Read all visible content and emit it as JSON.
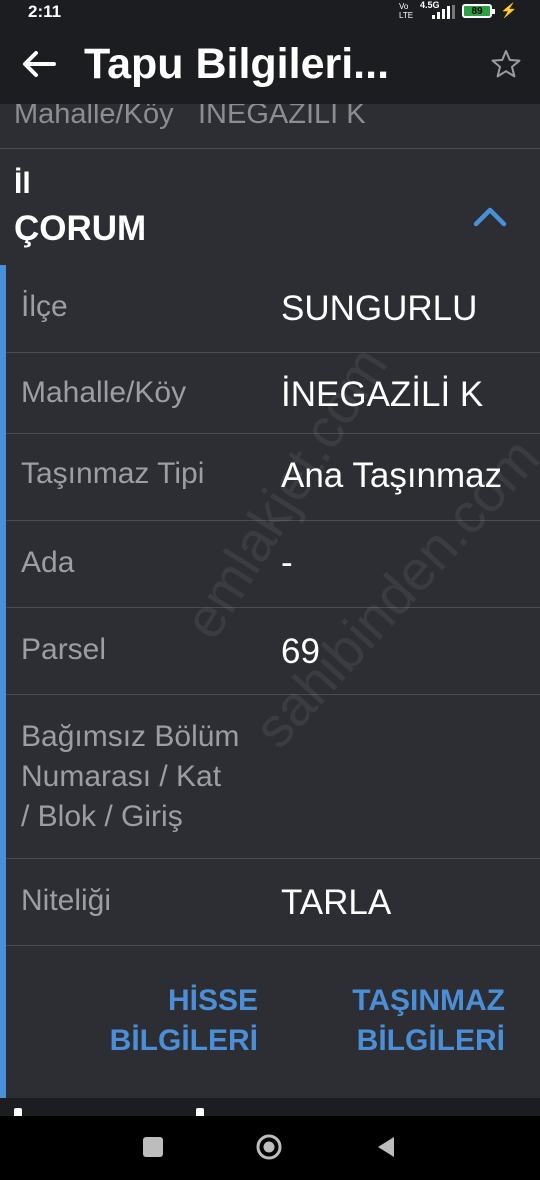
{
  "status_bar": {
    "time": "2:11",
    "volte": "Vo LTE",
    "network": "4.5G",
    "battery": "89"
  },
  "app_bar": {
    "title": "Tapu Bilgileri..."
  },
  "summary": {
    "label": "Mahalle/Köy",
    "value": "İNEGAZİLİ K"
  },
  "section": {
    "label": "İl",
    "value": "ÇORUM"
  },
  "rows": [
    {
      "label": "İlçe",
      "value": "SUNGURLU"
    },
    {
      "label": "Mahalle/Köy",
      "value": "İNEGAZİLİ K"
    },
    {
      "label": "Taşınmaz Tipi",
      "value": "Ana Taşınmaz"
    },
    {
      "label": "Ada",
      "value": "-"
    },
    {
      "label": "Parsel",
      "value": "69"
    },
    {
      "label_lines": [
        "Bağımsız Bölüm",
        "Numarası / Kat",
        "/ Blok / Giriş"
      ],
      "value": ""
    },
    {
      "label": "Niteliği",
      "value": "TARLA"
    }
  ],
  "buttons": {
    "hisse": [
      "HİSSE",
      "BİLGİLERİ"
    ],
    "tasinmaz": [
      "TAŞINMAZ",
      "BİLGİLERİ"
    ]
  },
  "watermark": {
    "text1": "emlakjet.com",
    "text2": "sahibinden.com"
  },
  "colors": {
    "accent": "#4a90d9",
    "background": "#1c1d20",
    "card": "#2c2e33",
    "link": "#4a8fd8"
  }
}
